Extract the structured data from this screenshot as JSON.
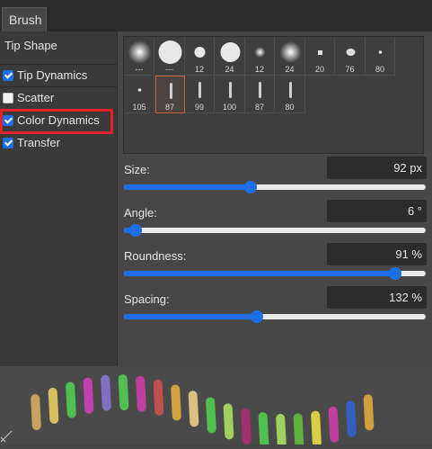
{
  "tab": {
    "label": "Brush"
  },
  "left_panel": {
    "header": "Tip Shape",
    "options": [
      {
        "label": "Tip Dynamics",
        "checked": true
      },
      {
        "label": "Scatter",
        "checked": false
      },
      {
        "label": "Color Dynamics",
        "checked": true,
        "highlighted": true
      },
      {
        "label": "Transfer",
        "checked": true
      }
    ]
  },
  "presets": [
    {
      "label": "---",
      "kind": "soft"
    },
    {
      "label": "---",
      "kind": "hard"
    },
    {
      "label": "12",
      "kind": "hard"
    },
    {
      "label": "24",
      "kind": "hard"
    },
    {
      "label": "12",
      "kind": "soft"
    },
    {
      "label": "24",
      "kind": "soft"
    },
    {
      "label": "20",
      "kind": "square"
    },
    {
      "label": "76",
      "kind": "blob"
    },
    {
      "label": "80",
      "kind": "dot"
    },
    {
      "label": "105",
      "kind": "dot"
    },
    {
      "label": "87",
      "kind": "stroke",
      "selected": true
    },
    {
      "label": "99",
      "kind": "stroke"
    },
    {
      "label": "100",
      "kind": "stroke"
    },
    {
      "label": "87",
      "kind": "stroke"
    },
    {
      "label": "80",
      "kind": "stroke"
    }
  ],
  "params": {
    "size": {
      "label": "Size:",
      "value": "92  px",
      "fraction": 0.42
    },
    "angle": {
      "label": "Angle:",
      "value": "6 °",
      "fraction": 0.04
    },
    "roundness": {
      "label": "Roundness:",
      "value": "91 %",
      "fraction": 0.9
    },
    "spacing": {
      "label": "Spacing:",
      "value": "132 %",
      "fraction": 0.44
    }
  },
  "colors": {
    "accent": "#1d6fe5",
    "highlight": "#e4202b",
    "stroke_colors": [
      "#c8a060",
      "#d8c060",
      "#50c050",
      "#c040b0",
      "#8070c0",
      "#50c050",
      "#c040a0",
      "#c05050",
      "#d0a040",
      "#d8c080",
      "#50c050",
      "#a0d060",
      "#a03070",
      "#50c050",
      "#a0d060",
      "#60b040",
      "#d8d040",
      "#c040a0",
      "#3060c0",
      "#d0a040"
    ]
  }
}
